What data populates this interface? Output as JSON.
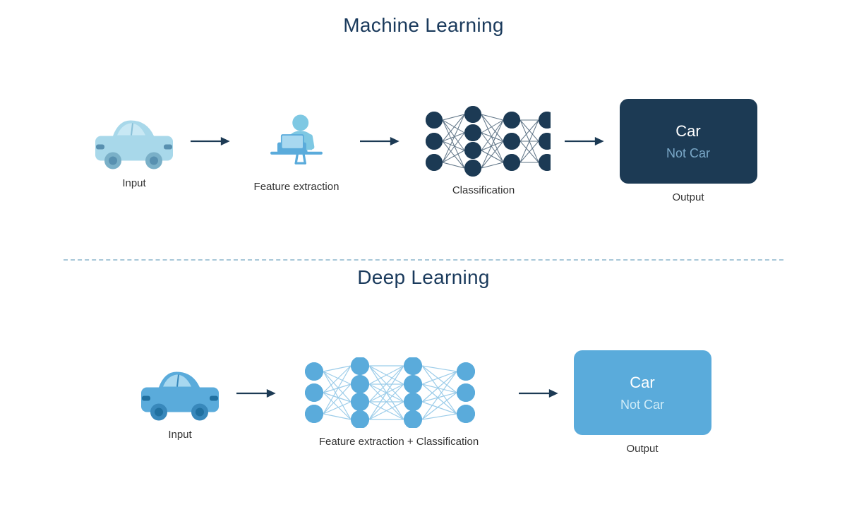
{
  "ml_section": {
    "title": "Machine Learning",
    "items": [
      {
        "id": "input",
        "label": "Input"
      },
      {
        "id": "feature",
        "label": "Feature extraction"
      },
      {
        "id": "classification",
        "label": "Classification"
      },
      {
        "id": "output",
        "label": "Output"
      }
    ],
    "output_box": {
      "line1": "Car",
      "line2": "Not Car"
    }
  },
  "dl_section": {
    "title": "Deep Learning",
    "items": [
      {
        "id": "input",
        "label": "Input"
      },
      {
        "id": "feat_class",
        "label": "Feature extraction + Classification"
      },
      {
        "id": "output",
        "label": "Output"
      }
    ],
    "output_box": {
      "line1": "Car",
      "line2": "Not Car"
    }
  },
  "colors": {
    "light_blue": "#7ec8e3",
    "mid_blue": "#5aabdb",
    "dark_blue": "#1c3a54",
    "node_dark": "#1c3a54",
    "node_light": "#5aabdb",
    "arrow_dark": "#1c3a54",
    "title_color": "#1a3a5c"
  }
}
